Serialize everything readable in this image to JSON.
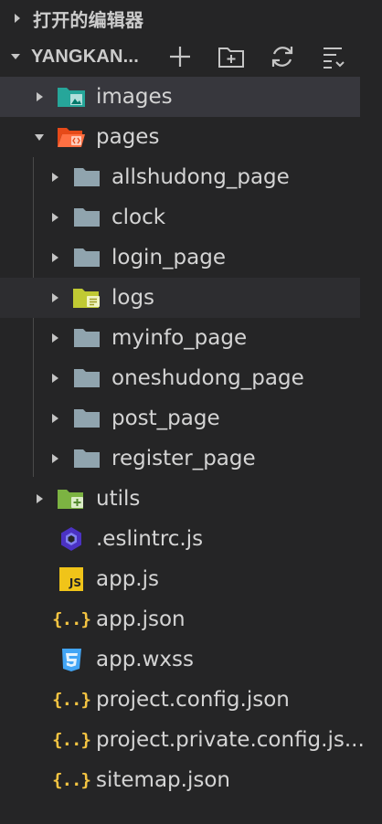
{
  "open_editors": {
    "label": "打开的编辑器"
  },
  "project": {
    "name": "YANGKAN..."
  },
  "tree": {
    "images": "images",
    "pages": "pages",
    "allshudong_page": "allshudong_page",
    "clock": "clock",
    "login_page": "login_page",
    "logs": "logs",
    "myinfo_page": "myinfo_page",
    "oneshudong_page": "oneshudong_page",
    "post_page": "post_page",
    "register_page": "register_page",
    "utils": "utils",
    "eslintrc": ".eslintrc.js",
    "app_js": "app.js",
    "app_json": "app.json",
    "app_wxss": "app.wxss",
    "project_config": "project.config.json",
    "project_private_config": "project.private.config.js...",
    "sitemap": "sitemap.json"
  },
  "icons": {
    "json_glyph": "{..}",
    "js_badge": "JS"
  },
  "colors": {
    "background": "#252526",
    "selected_row": "#37373d",
    "folder_gray": "#90a4ae",
    "folder_teal": "#26a69a",
    "folder_pages": "#ff7043",
    "folder_logs": "#c0ca33",
    "folder_utils": "#7cb342",
    "json_yellow": "#f5c542",
    "js_yellow": "#f0c419",
    "css_blue": "#42a5f5",
    "eslint_purple": "#5c5fd6"
  }
}
